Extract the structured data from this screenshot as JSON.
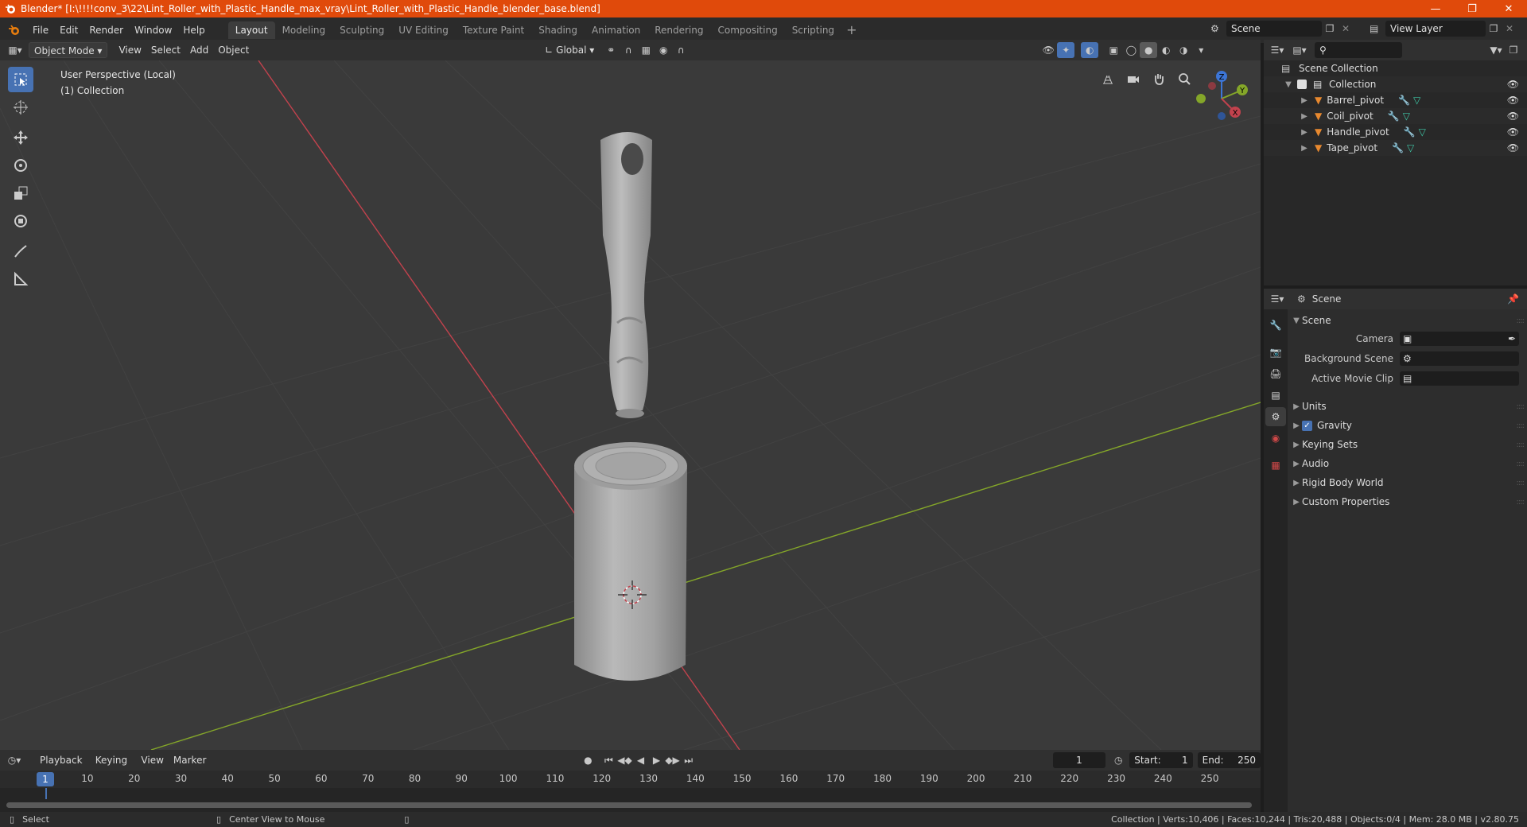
{
  "window": {
    "title": "Blender* [I:\\!!!!conv_3\\22\\Lint_Roller_with_Plastic_Handle_max_vray\\Lint_Roller_with_Plastic_Handle_blender_base.blend]"
  },
  "menu": {
    "file": "File",
    "edit": "Edit",
    "render": "Render",
    "window": "Window",
    "help": "Help"
  },
  "workspaces": [
    "Layout",
    "Modeling",
    "Sculpting",
    "UV Editing",
    "Texture Paint",
    "Shading",
    "Animation",
    "Rendering",
    "Compositing",
    "Scripting"
  ],
  "active_workspace": "Layout",
  "scene_selector": "Scene",
  "view_layer_selector": "View Layer",
  "viewport_header": {
    "mode": "Object Mode",
    "view": "View",
    "select": "Select",
    "add": "Add",
    "object": "Object",
    "transform_orientation": "Global"
  },
  "viewport": {
    "perspective_label": "User Perspective (Local)",
    "collection_label": "(1) Collection",
    "gizmo_axes": [
      "Z",
      "Y",
      "X"
    ]
  },
  "outliner": {
    "root": "Scene Collection",
    "collection": "Collection",
    "items": [
      {
        "name": "Barrel_pivot"
      },
      {
        "name": "Coil_pivot"
      },
      {
        "name": "Handle_pivot"
      },
      {
        "name": "Tape_pivot"
      }
    ]
  },
  "properties": {
    "context": "Scene",
    "panel_title": "Scene",
    "fields": [
      {
        "label": "Camera",
        "value": ""
      },
      {
        "label": "Background Scene",
        "value": ""
      },
      {
        "label": "Active Movie Clip",
        "value": ""
      }
    ],
    "sections": [
      {
        "label": "Units",
        "checkbox": false
      },
      {
        "label": "Gravity",
        "checkbox": true,
        "checked": true
      },
      {
        "label": "Keying Sets",
        "checkbox": false
      },
      {
        "label": "Audio",
        "checkbox": false
      },
      {
        "label": "Rigid Body World",
        "checkbox": false
      },
      {
        "label": "Custom Properties",
        "checkbox": false
      }
    ]
  },
  "timeline": {
    "playback": "Playback",
    "keying": "Keying",
    "view": "View",
    "marker": "Marker",
    "current_frame": "1",
    "start_label": "Start:",
    "start_value": "1",
    "end_label": "End:",
    "end_value": "250",
    "ruler": [
      "1",
      "10",
      "20",
      "30",
      "40",
      "50",
      "60",
      "70",
      "80",
      "90",
      "100",
      "110",
      "120",
      "130",
      "140",
      "150",
      "160",
      "170",
      "180",
      "190",
      "200",
      "210",
      "220",
      "230",
      "240",
      "250"
    ]
  },
  "statusbar": {
    "select": "Select",
    "center_view": "Center View to Mouse",
    "stats": "Collection | Verts:10,406 | Faces:10,244 | Tris:20,488 | Objects:0/4 | Mem: 28.0 MB | v2.80.75"
  },
  "colors": {
    "title_bar": "#e04a0b",
    "accent": "#4772b3",
    "x_axis": "#c2424d",
    "y_axis": "#84a629",
    "z_axis": "#3c75d6"
  }
}
